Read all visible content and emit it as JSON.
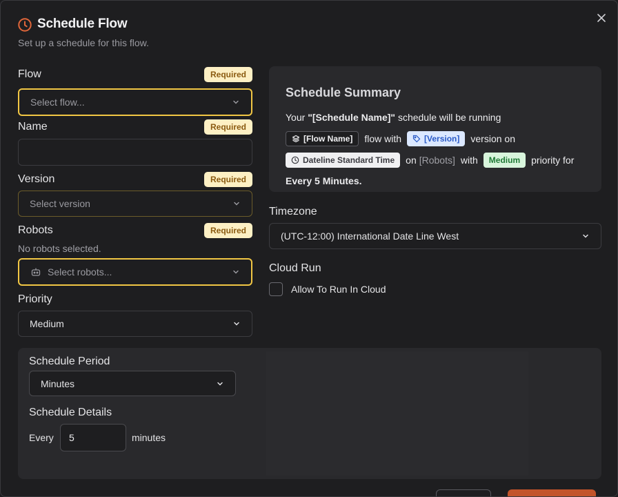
{
  "header": {
    "title": "Schedule Flow",
    "subtitle": "Set up a schedule for this flow."
  },
  "form": {
    "required_badge": "Required",
    "flow": {
      "label": "Flow",
      "placeholder": "Select flow..."
    },
    "name": {
      "label": "Name",
      "value": ""
    },
    "version": {
      "label": "Version",
      "placeholder": "Select version"
    },
    "robots": {
      "label": "Robots",
      "note": "No robots selected.",
      "placeholder": "Select robots..."
    },
    "priority": {
      "label": "Priority",
      "value": "Medium"
    }
  },
  "summary": {
    "title": "Schedule Summary",
    "line1_prefix": "Your ",
    "schedule_name": "\"[Schedule Name]\"",
    "line1_suffix": " schedule will be running",
    "flow_chip": "[Flow Name]",
    "flow_with": "flow with",
    "version_chip": "[Version]",
    "version_on": "version on",
    "timezone_chip": "Dateline Standard Time",
    "on_text": "on",
    "robots_text": "[Robots]",
    "with_text": "with",
    "priority_chip": "Medium",
    "priority_for": "priority for",
    "frequency": "Every 5 Minutes",
    "period_end": "."
  },
  "timezone": {
    "label": "Timezone",
    "value": "(UTC-12:00) International Date Line West"
  },
  "cloud_run": {
    "label": "Cloud Run",
    "checkbox_label": "Allow To Run In Cloud",
    "checked": false
  },
  "schedule": {
    "period_label": "Schedule Period",
    "period_value": "Minutes",
    "details_label": "Schedule Details",
    "every_label": "Every",
    "every_value": "5",
    "unit_label": "minutes"
  },
  "colors": {
    "accent_orange": "#c2542a",
    "focus_yellow": "#f2c744",
    "badge_bg": "#fdf0c4",
    "badge_text": "#8a5a10"
  },
  "icons": [
    "clock-icon",
    "close-icon",
    "chevron-down-icon",
    "robot-icon",
    "layers-icon",
    "tag-icon"
  ]
}
